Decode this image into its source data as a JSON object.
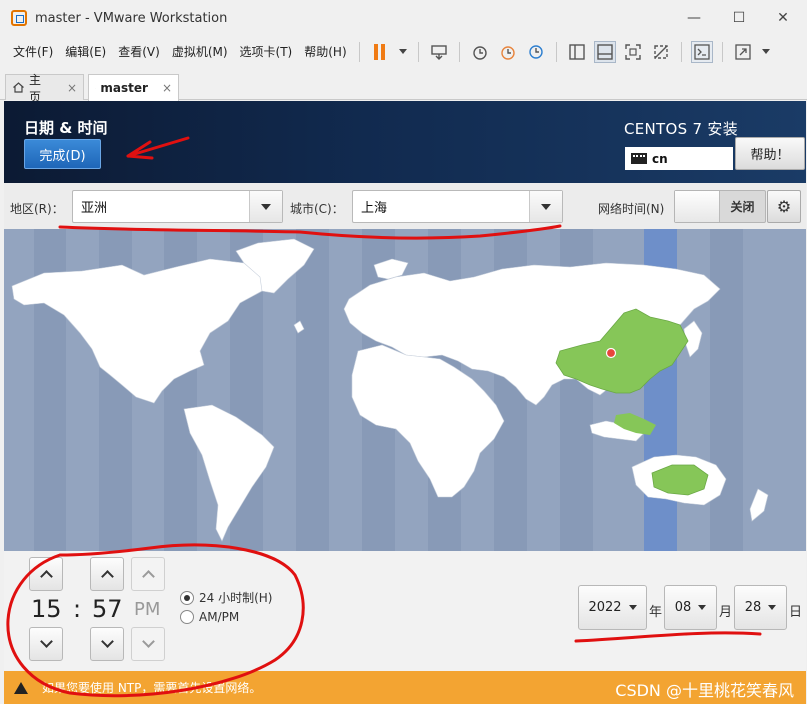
{
  "window": {
    "title": "master - VMware Workstation",
    "minimize_glyph": "—",
    "maximize_glyph": "☐",
    "close_glyph": "✕"
  },
  "menu": {
    "items": [
      "文件(F)",
      "编辑(E)",
      "查看(V)",
      "虚拟机(M)",
      "选项卡(T)",
      "帮助(H)"
    ]
  },
  "tabs": [
    {
      "label": "主页",
      "icon": "home-icon",
      "close": "×"
    },
    {
      "label": "master",
      "icon": "vm-icon",
      "close": "×"
    }
  ],
  "installer": {
    "title": "日期 & 时间",
    "done_label": "完成(D)",
    "os_title": "CENTOS 7 安装",
    "keyboard_layout": "cn",
    "help_label": "帮助！"
  },
  "region": {
    "region_label": "地区(R)：",
    "region_value": "亚洲",
    "city_label": "城市(C)：",
    "city_value": "上海",
    "network_time_label": "网络时间(N)",
    "network_time_state": "关闭"
  },
  "time": {
    "hour": "15",
    "separator": ":",
    "minute": "57",
    "ampm": "PM",
    "format_24h_label": "24 小时制(H)",
    "format_ampm_label": "AM/PM",
    "format_24h_selected": true
  },
  "date": {
    "year": "2022",
    "year_unit": "年",
    "month": "08",
    "month_unit": "月",
    "day": "28",
    "day_unit": "日"
  },
  "warning": {
    "text": "如果您要使用 NTP，需要首先设置网络。",
    "watermark": "CSDN @十里桃花笑春风"
  },
  "colors": {
    "header_bg": "#112a4f",
    "done_button": "#2a74c6",
    "map_ocean": "#93a4bf",
    "land": "#ffffff",
    "selected_region": "#86c658",
    "warning_bar": "#f3a432",
    "annotation": "#e01010"
  }
}
